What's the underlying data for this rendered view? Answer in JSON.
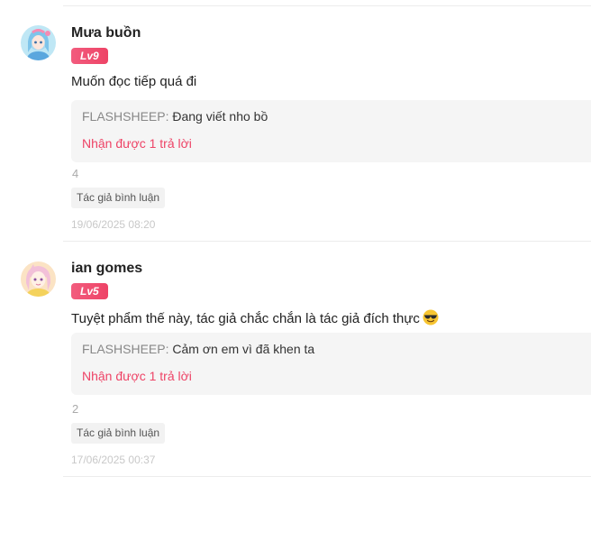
{
  "comments": [
    {
      "username": "Mưa buồn",
      "level": "Lv9",
      "text": "Muốn đọc tiếp quá đi",
      "reply_author": "FLASHSHEEP",
      "reply_separator": ":",
      "reply_text": " Đang viết nho bồ",
      "reply_count_label": "Nhận được 1 trả lời",
      "like_count": "4",
      "author_tag": "Tác giả bình luận",
      "timestamp": "19/06/2025 08:20",
      "avatar_icon": "anime-girl-avatar-icon"
    },
    {
      "username": "ian gomes",
      "level": "Lv5",
      "text": "Tuyệt phẩm thế này, tác giả chắc chắn là tác giả đích thực",
      "emoji": "smiling-face-with-sunglasses-emoji",
      "reply_author": "FLASHSHEEP",
      "reply_separator": ":",
      "reply_text": " Cảm ơn em vì đã khen ta",
      "reply_count_label": "Nhận được 1 trả lời",
      "like_count": "2",
      "author_tag": "Tác giả bình luận",
      "timestamp": "17/06/2025 00:37",
      "avatar_icon": "anime-girl-avatar-icon"
    }
  ],
  "colors": {
    "accent": "#ee4366",
    "badge": "#f25c7e",
    "reply_bg": "#f5f5f5",
    "muted": "#aaaaaa"
  }
}
